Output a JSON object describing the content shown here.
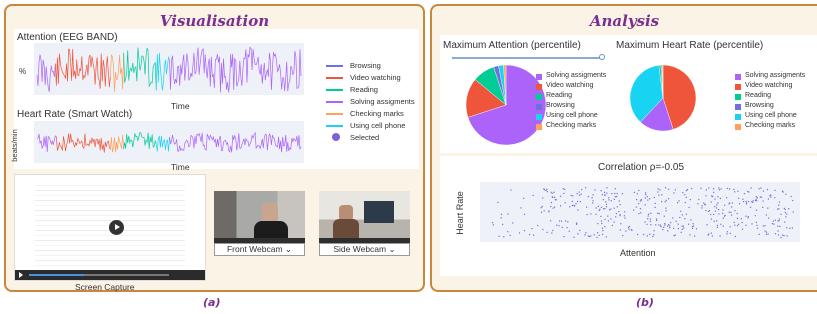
{
  "left_panel": {
    "title": "Visualisation",
    "attention_chart": {
      "title": "Attention (EEG BAND)",
      "ylabel": "%",
      "xlabel": "Time"
    },
    "heart_chart": {
      "title": "Heart Rate (Smart Watch)",
      "ylabel": "beats/min",
      "xlabel": "Time"
    },
    "legend": [
      {
        "label": "Browsing",
        "color": "#6f6fe0",
        "style": "line"
      },
      {
        "label": "Video watching",
        "color": "#ef553b",
        "style": "line"
      },
      {
        "label": "Reading",
        "color": "#00cc96",
        "style": "line"
      },
      {
        "label": "Solving assigments",
        "color": "#ab63fa",
        "style": "line"
      },
      {
        "label": "Checking marks",
        "color": "#ffa15a",
        "style": "line"
      },
      {
        "label": "Using cell phone",
        "color": "#19d3f3",
        "style": "line"
      },
      {
        "label": "Selected",
        "color": "#7f5fdc",
        "style": "dot"
      }
    ],
    "screen_capture_label": "Screen Capture",
    "front_webcam_label": "Front Webcam",
    "side_webcam_label": "Side Webcam",
    "caption": "(a)"
  },
  "right_panel": {
    "title": "Analysis",
    "max_attention_title": "Maximum Attention (percentile)",
    "max_heart_title": "Maximum Heart Rate (percentile)",
    "legend": [
      {
        "label": "Solving assigments",
        "color": "#ab63fa"
      },
      {
        "label": "Video watching",
        "color": "#ef553b"
      },
      {
        "label": "Reading",
        "color": "#00cc96"
      },
      {
        "label": "Browsing",
        "color": "#6f6fe0"
      },
      {
        "label": "Using cell phone",
        "color": "#19d3f3"
      },
      {
        "label": "Checking marks",
        "color": "#ffa15a"
      }
    ],
    "correlation_title": "Correlation ρ=-0.05",
    "scatter_xlabel": "Attention",
    "scatter_ylabel": "Heart Rate",
    "caption": "(b)"
  },
  "chart_data": [
    {
      "type": "pie",
      "title": "Maximum Attention (percentile)",
      "labels": [
        "Solving assigments",
        "Video watching",
        "Reading",
        "Browsing",
        "Using cell phone",
        "Checking marks"
      ],
      "values": [
        70,
        16,
        9,
        2,
        2,
        1
      ]
    },
    {
      "type": "pie",
      "title": "Maximum Heart Rate (percentile)",
      "labels": [
        "Video watching",
        "Solving assigments",
        "Using cell phone",
        "Reading",
        "Browsing",
        "Checking marks"
      ],
      "values": [
        45,
        17,
        36,
        1,
        0.5,
        0.5
      ]
    },
    {
      "type": "scatter",
      "title": "Correlation ρ=-0.05",
      "xlabel": "Attention",
      "ylabel": "Heart Rate"
    }
  ]
}
